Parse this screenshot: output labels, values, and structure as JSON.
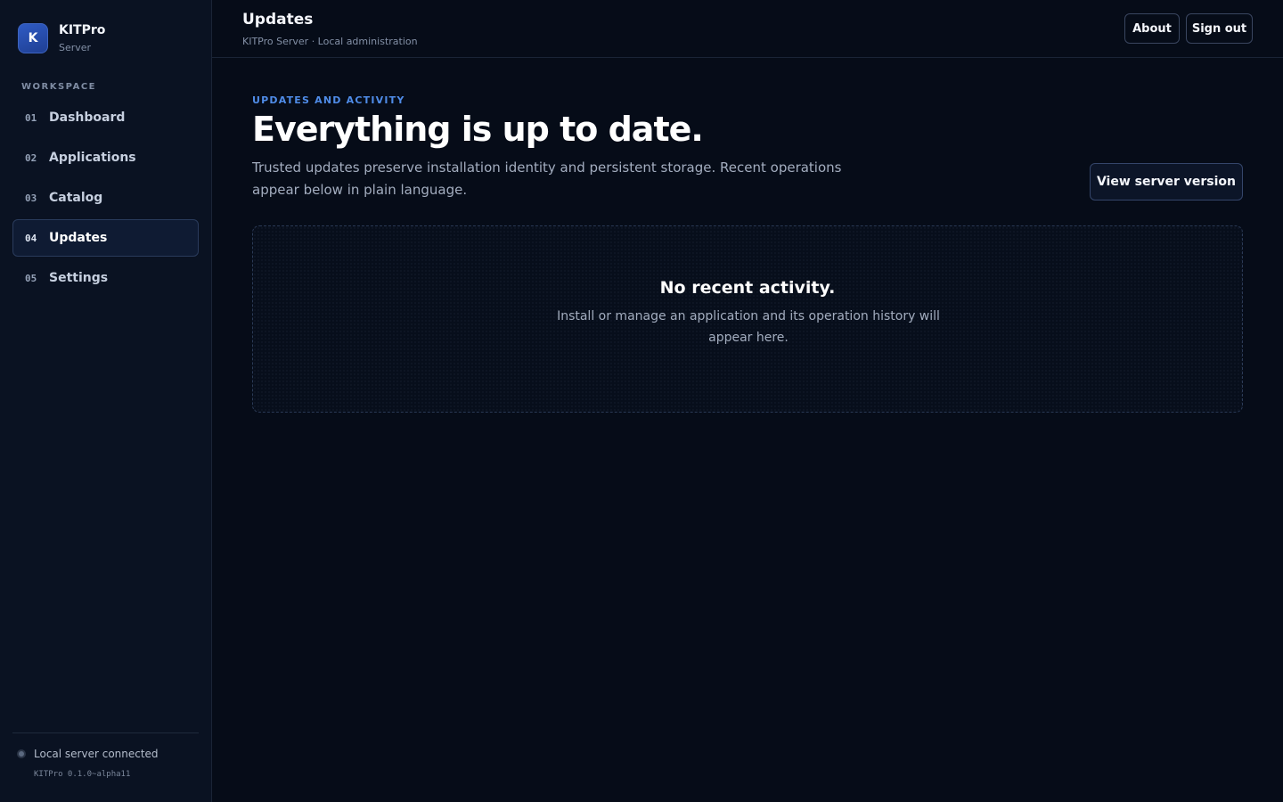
{
  "sidebar": {
    "brand": {
      "logo_letter": "K",
      "name": "KITPro",
      "subtitle": "Server"
    },
    "section_label": "WORKSPACE",
    "items": [
      {
        "num": "01",
        "label": "Dashboard",
        "active": false
      },
      {
        "num": "02",
        "label": "Applications",
        "active": false
      },
      {
        "num": "03",
        "label": "Catalog",
        "active": false
      },
      {
        "num": "04",
        "label": "Updates",
        "active": true
      },
      {
        "num": "05",
        "label": "Settings",
        "active": false
      }
    ],
    "footer": {
      "status_text": "Local server connected",
      "version": "KITPro 0.1.0~alpha11"
    }
  },
  "header": {
    "title": "Updates",
    "subtitle": "KITPro Server · Local administration",
    "about_label": "About",
    "signout_label": "Sign out"
  },
  "main": {
    "eyebrow": "UPDATES AND ACTIVITY",
    "headline": "Everything is up to date.",
    "lede": "Trusted updates preserve installation identity and persistent storage. Recent operations appear below in plain language.",
    "version_button_label": "View server version",
    "empty_state": {
      "title": "No recent activity.",
      "body": "Install or manage an application and its operation history will appear here."
    }
  },
  "colors": {
    "accent": "#4f8ce8",
    "background": "#060c18",
    "sidebar": "#0a1222"
  }
}
